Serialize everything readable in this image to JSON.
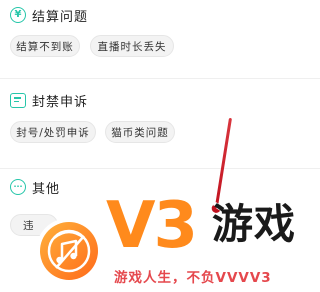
{
  "sections": [
    {
      "title": "结算问题",
      "icon": "yen-icon",
      "icon_glyph": "¥",
      "chips": [
        "结算不到账",
        "直播时长丢失"
      ]
    },
    {
      "title": "封禁申诉",
      "icon": "message-square-icon",
      "chips": [
        "封号/处罚申诉",
        "猫币类问题"
      ]
    },
    {
      "title": "其他",
      "icon": "more-dots-icon",
      "icon_glyph": "···",
      "chips": [
        "违"
      ]
    }
  ],
  "watermark": {
    "logo": "music-disc-logo",
    "brand": "V3",
    "name": "游戏",
    "slogan": "游戏人生，不负VVVV3"
  },
  "colors": {
    "accent": "#26c6a9",
    "brand_orange": "#ff8a1c",
    "slogan_red": "#e5484d",
    "annotation_red": "#c1121f"
  }
}
